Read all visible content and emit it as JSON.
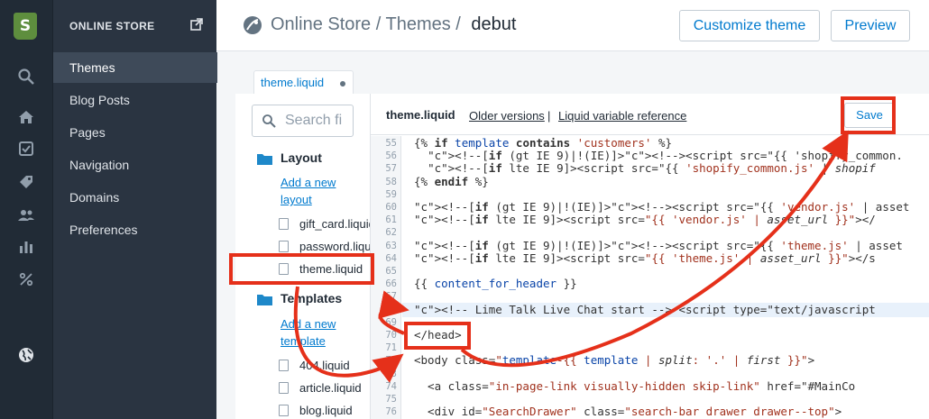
{
  "rail": {
    "logo_glyph": "S",
    "icons": [
      "search-icon",
      "home-icon",
      "orders-icon",
      "tag-icon",
      "customers-icon",
      "analytics-icon",
      "discounts-icon",
      "globe-icon"
    ]
  },
  "subnav": {
    "title": "ONLINE STORE",
    "items": [
      {
        "label": "Themes",
        "active": true
      },
      {
        "label": "Blog Posts"
      },
      {
        "label": "Pages"
      },
      {
        "label": "Navigation"
      },
      {
        "label": "Domains"
      },
      {
        "label": "Preferences"
      }
    ]
  },
  "header": {
    "breadcrumb": "Online Store / Themes /",
    "current": "debut",
    "customize_label": "Customize theme",
    "preview_label": "Preview"
  },
  "editor_tab": {
    "label": "theme.liquid"
  },
  "files": {
    "search_placeholder": "Search fi",
    "layout": {
      "label": "Layout",
      "add_label": "Add a new layout",
      "items": [
        "gift_card.liquid",
        "password.liquid",
        "theme.liquid"
      ]
    },
    "templates": {
      "label": "Templates",
      "add_label": "Add a new template",
      "items": [
        "404.liquid",
        "article.liquid",
        "blog.liquid"
      ]
    }
  },
  "code": {
    "filename": "theme.liquid",
    "older_versions": "Older versions",
    "liquid_ref": "Liquid variable reference",
    "separator": "|",
    "save_label": "Save",
    "line_numbers": [
      "55",
      "56",
      "57",
      "58",
      "59",
      "60",
      "61",
      "62",
      "63",
      "64",
      "65",
      "66",
      "67",
      "68",
      "69",
      "70",
      "71",
      "72",
      "73",
      "74",
      "75",
      "76"
    ],
    "lines": [
      "{% if template contains 'customers' %}",
      "  <!--[if (gt IE 9)|!(IE)]><!--><script src=\"{{ 'shopify_common.",
      "  <!--[if lte IE 9]><script src=\"{{ 'shopify_common.js' | shopif",
      "{% endif %}",
      "",
      "<!--[if (gt IE 9)|!(IE)]><!--><script src=\"{{ 'vendor.js' | asset",
      "<!--[if lte IE 9]><script src=\"{{ 'vendor.js' | asset_url }}\"></",
      "",
      "<!--[if (gt IE 9)|!(IE)]><!--><script src=\"{{ 'theme.js' | asset",
      "<!--[if lte IE 9]><script src=\"{{ 'theme.js' | asset_url }}\"></s",
      "",
      "{{ content_for_header }}",
      "",
      "<!-- Lime Talk Live Chat start --> <script type=\"text/javascript",
      "",
      "</head>",
      "",
      "<body class=\"template-{{ template | split: '.' | first }}\">",
      "",
      "  <a class=\"in-page-link visually-hidden skip-link\" href=\"#MainCo",
      "",
      "  <div id=\"SearchDrawer\" class=\"search-bar drawer drawer--top\">"
    ]
  },
  "annotation": {
    "color": "#e5301a"
  }
}
